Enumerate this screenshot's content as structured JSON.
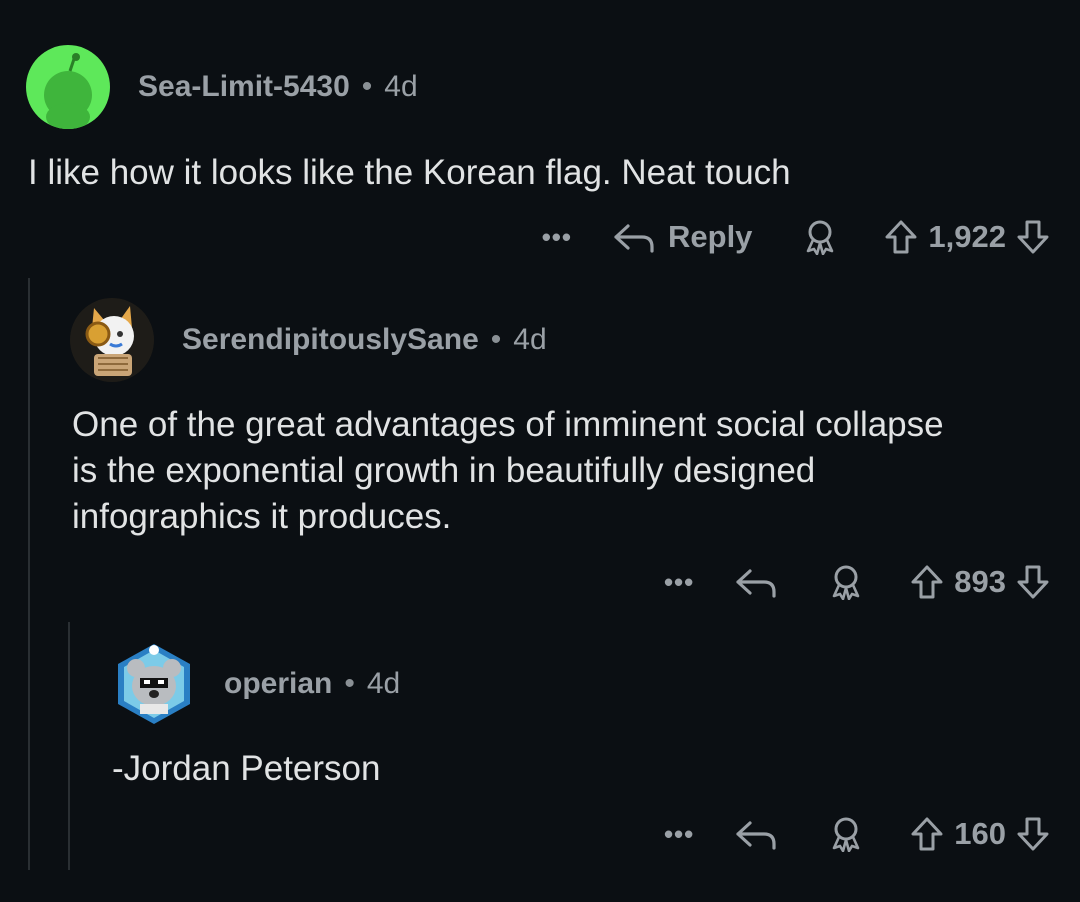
{
  "comments": [
    {
      "username": "Sea-Limit-5430",
      "separator": "•",
      "time": "4d",
      "text": "I like how it looks like the Korean flag. Neat touch",
      "reply_label": "Reply",
      "more": "•••",
      "score": "1,922"
    },
    {
      "username": "SerendipitouslySane",
      "separator": "•",
      "time": "4d",
      "text": "One of the great advantages of imminent social collapse\nis the exponential growth in beautifully designed\ninfographics it produces.",
      "more": "•••",
      "score": "893"
    },
    {
      "username": "operian",
      "separator": "•",
      "time": "4d",
      "text": "-Jordan Peterson",
      "more": "•••",
      "score": "160"
    }
  ],
  "colors": {
    "background": "#0b0f13",
    "text": "#e1e3e4",
    "muted": "#9aa0a6",
    "avatar1": "#5ee85a"
  },
  "icons": [
    "ellipsis-icon",
    "reply-arrow-icon",
    "award-icon",
    "upvote-icon",
    "downvote-icon"
  ]
}
